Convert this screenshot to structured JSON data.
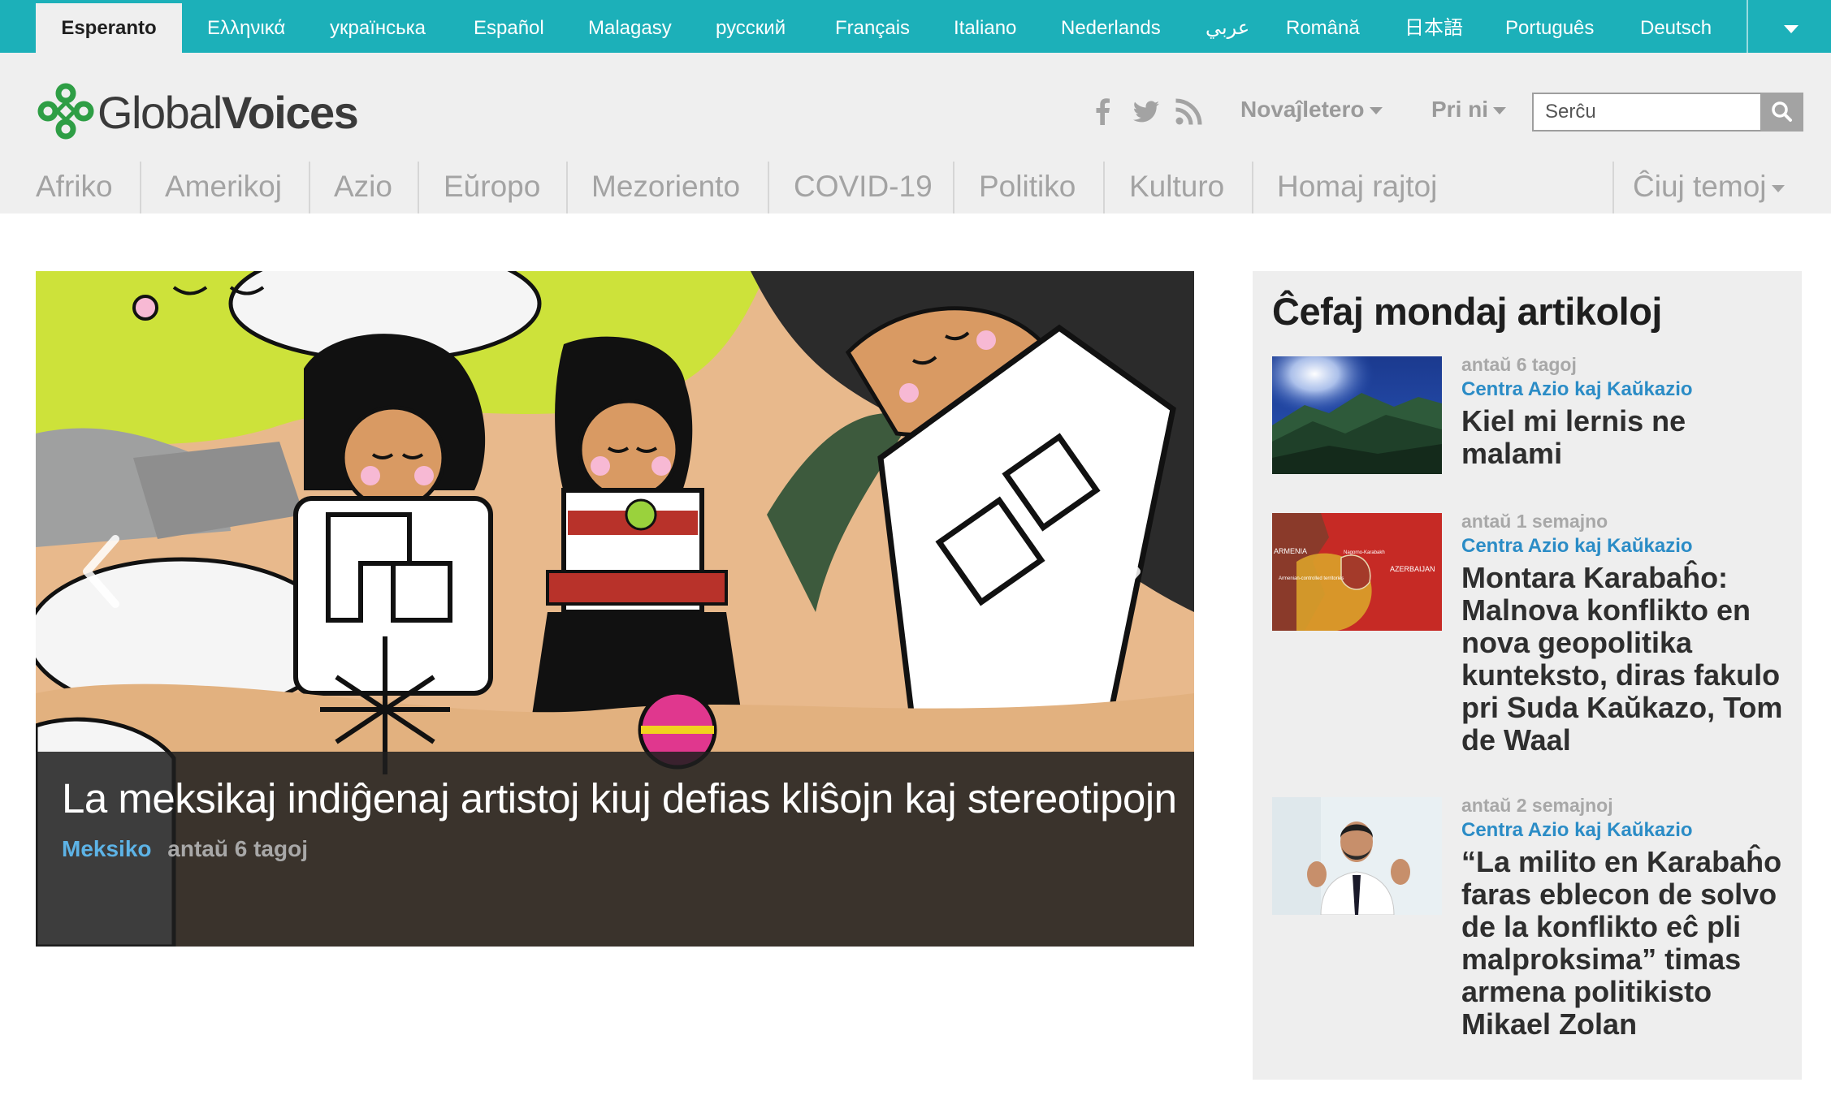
{
  "languages": {
    "items": [
      {
        "label": "Esperanto",
        "active": true
      },
      {
        "label": "Ελληνικά"
      },
      {
        "label": "українська"
      },
      {
        "label": "Español"
      },
      {
        "label": "Malagasy"
      },
      {
        "label": "русский"
      },
      {
        "label": "Français"
      },
      {
        "label": "Italiano"
      },
      {
        "label": "Nederlands"
      },
      {
        "label": "عربي"
      },
      {
        "label": "Română"
      },
      {
        "label": "日本語"
      },
      {
        "label": "Português"
      },
      {
        "label": "Deutsch"
      }
    ],
    "more_icon": "chevron-down-icon"
  },
  "header": {
    "logo": {
      "part1": "Global",
      "part2": "Voices"
    },
    "social_icons": [
      "facebook-icon",
      "twitter-icon",
      "rss-icon"
    ],
    "newsletter_label": "Novaĵletero",
    "about_label": "Pri ni",
    "search": {
      "placeholder": "Serĉu",
      "icon": "search-icon"
    }
  },
  "nav": {
    "items": [
      {
        "label": "Afriko"
      },
      {
        "label": "Amerikoj"
      },
      {
        "label": "Azio"
      },
      {
        "label": "Eŭropo"
      },
      {
        "label": "Mezoriento"
      },
      {
        "label": "COVID-19"
      },
      {
        "label": "Politiko"
      },
      {
        "label": "Kulturo"
      },
      {
        "label": "Homaj rajtoj"
      }
    ],
    "all_topics_label": "Ĉiuj temoj"
  },
  "hero": {
    "title": "La meksikaj indiĝenaj artistoj kiuj defias kliŝojn kaj stereotipojn",
    "category": "Meksiko",
    "time": "antaŭ 6 tagoj"
  },
  "sidebar": {
    "title": "Ĉefaj mondaj artikoloj",
    "articles": [
      {
        "time": "antaŭ 6 tagoj",
        "category": "Centra Azio kaj Kaŭkazio",
        "title": "Kiel mi lernis ne malami"
      },
      {
        "time": "antaŭ 1 semajno",
        "category": "Centra Azio kaj Kaŭkazio",
        "title": "Montara Karabaĥo: Malnova konflikto en nova geopolitika kunteksto, diras fakulo pri Suda Kaŭkazo, Tom de Waal"
      },
      {
        "time": "antaŭ 2 semajnoj",
        "category": "Centra Azio kaj Kaŭkazio",
        "title": "“La milito en Karabaĥo faras eblecon de solvo de la konflikto eĉ pli malproksima” timas armena politikisto Mikael Zolan"
      }
    ],
    "map_labels": {
      "armenia": "ARMENIA",
      "azerbaijan": "AZERBAIJAN",
      "nk": "Nagorno-Karabakh",
      "controlled": "Armenian-controlled territories"
    }
  },
  "colors": {
    "language_bar": "#1cb0b9",
    "header_bg": "#efefef",
    "category_link": "#2b8cc6",
    "hero_category": "#5db3e6",
    "logo_green": "#2e9e45"
  }
}
